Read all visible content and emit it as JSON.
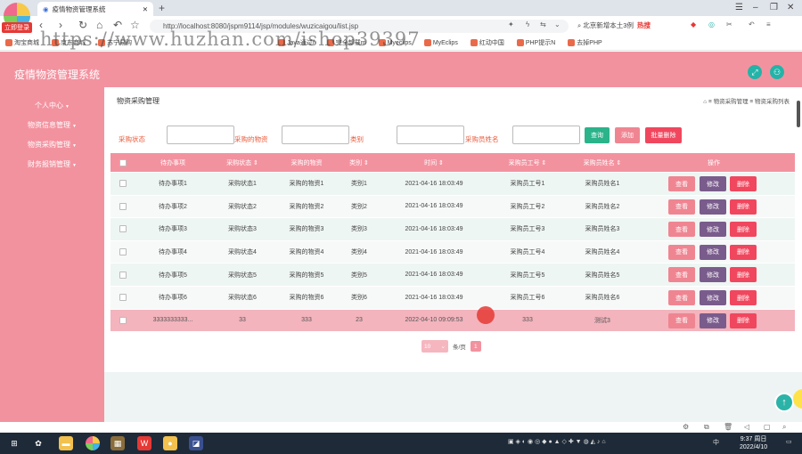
{
  "browser": {
    "tab_title": "疫情物资管理系统",
    "url": "http://localhost:8080/jspm9114/jsp/modules/wuzicaigou/list.jsp",
    "search_text": "北京新增本土3例",
    "hot_label": "热搜",
    "login_badge": "立即登录",
    "watermark": "https://www.huzhan.com/ishop39397",
    "bookmarks": [
      "淘宝商城",
      "京东商城",
      "苏宁易购",
      "Java通过/",
      "完全卸载m",
      "Myeclips",
      "MyEclips",
      "红动中国",
      "PHP提示N",
      "去掉PHP"
    ]
  },
  "app": {
    "title": "疫情物资管理系统",
    "sidebar": [
      {
        "label": "个人中心"
      },
      {
        "label": "物资信息管理"
      },
      {
        "label": "物资采购管理"
      },
      {
        "label": "财务报销管理"
      }
    ],
    "page_title": "物资采购管理",
    "breadcrumb": "⌂ ≡ 物资采购管理 ≡ 物资采购列表",
    "filters": {
      "status_label": "采购状态",
      "material_label": "采购的物资",
      "category_label": "类别",
      "buyer_label": "采购员姓名",
      "search_btn": "查询",
      "add_btn": "添加",
      "batch_delete_btn": "批量删除"
    },
    "table": {
      "headers": [
        "待办事项",
        "采购状态 ⇕",
        "采购的物资",
        "类别 ⇕",
        "时间 ⇕",
        "采购员工号 ⇕",
        "采购员姓名 ⇕",
        "操作"
      ],
      "rows": [
        {
          "todo": "待办事项1",
          "status": "采购状态1",
          "material": "采购的物资1",
          "category": "类别1",
          "time": "2021-04-16 18:03:49",
          "emp_no": "采购员工号1",
          "name": "采购员姓名1"
        },
        {
          "todo": "待办事项2",
          "status": "采购状态2",
          "material": "采购的物资2",
          "category": "类别2",
          "time": "2021-04-16 18:03:49",
          "emp_no": "采购员工号2",
          "name": "采购员姓名2"
        },
        {
          "todo": "待办事项3",
          "status": "采购状态3",
          "material": "采购的物资3",
          "category": "类别3",
          "time": "2021-04-16 18:03:49",
          "emp_no": "采购员工号3",
          "name": "采购员姓名3"
        },
        {
          "todo": "待办事项4",
          "status": "采购状态4",
          "material": "采购的物资4",
          "category": "类别4",
          "time": "2021-04-16 18:03:49",
          "emp_no": "采购员工号4",
          "name": "采购员姓名4"
        },
        {
          "todo": "待办事项5",
          "status": "采购状态5",
          "material": "采购的物资5",
          "category": "类别5",
          "time": "2021-04-16 18:03:49",
          "emp_no": "采购员工号5",
          "name": "采购员姓名5"
        },
        {
          "todo": "待办事项6",
          "status": "采购状态6",
          "material": "采购的物资6",
          "category": "类别6",
          "time": "2021-04-16 18:03:49",
          "emp_no": "采购员工号6",
          "name": "采购员姓名6"
        },
        {
          "todo": "3333333333...",
          "status": "33",
          "material": "333",
          "category": "23",
          "time": "2022-04-10 09:09:53",
          "emp_no": "333",
          "name": "测试3"
        }
      ],
      "actions": {
        "view": "查看",
        "edit": "修改",
        "delete": "删除"
      }
    },
    "pager": {
      "page_size": "10",
      "per_page_label": "条/页",
      "current_page": "1"
    }
  },
  "taskbar": {
    "time": "9:37 周日",
    "date": "2022/4/10",
    "ime": "中"
  }
}
